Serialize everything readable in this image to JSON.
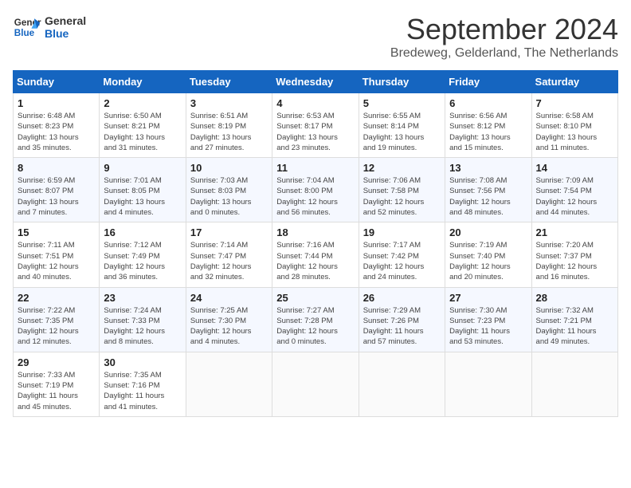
{
  "logo": {
    "line1": "General",
    "line2": "Blue"
  },
  "title": "September 2024",
  "subtitle": "Bredeweg, Gelderland, The Netherlands",
  "weekdays": [
    "Sunday",
    "Monday",
    "Tuesday",
    "Wednesday",
    "Thursday",
    "Friday",
    "Saturday"
  ],
  "weeks": [
    [
      {
        "day": "1",
        "info": "Sunrise: 6:48 AM\nSunset: 8:23 PM\nDaylight: 13 hours\nand 35 minutes."
      },
      {
        "day": "2",
        "info": "Sunrise: 6:50 AM\nSunset: 8:21 PM\nDaylight: 13 hours\nand 31 minutes."
      },
      {
        "day": "3",
        "info": "Sunrise: 6:51 AM\nSunset: 8:19 PM\nDaylight: 13 hours\nand 27 minutes."
      },
      {
        "day": "4",
        "info": "Sunrise: 6:53 AM\nSunset: 8:17 PM\nDaylight: 13 hours\nand 23 minutes."
      },
      {
        "day": "5",
        "info": "Sunrise: 6:55 AM\nSunset: 8:14 PM\nDaylight: 13 hours\nand 19 minutes."
      },
      {
        "day": "6",
        "info": "Sunrise: 6:56 AM\nSunset: 8:12 PM\nDaylight: 13 hours\nand 15 minutes."
      },
      {
        "day": "7",
        "info": "Sunrise: 6:58 AM\nSunset: 8:10 PM\nDaylight: 13 hours\nand 11 minutes."
      }
    ],
    [
      {
        "day": "8",
        "info": "Sunrise: 6:59 AM\nSunset: 8:07 PM\nDaylight: 13 hours\nand 7 minutes."
      },
      {
        "day": "9",
        "info": "Sunrise: 7:01 AM\nSunset: 8:05 PM\nDaylight: 13 hours\nand 4 minutes."
      },
      {
        "day": "10",
        "info": "Sunrise: 7:03 AM\nSunset: 8:03 PM\nDaylight: 13 hours\nand 0 minutes."
      },
      {
        "day": "11",
        "info": "Sunrise: 7:04 AM\nSunset: 8:00 PM\nDaylight: 12 hours\nand 56 minutes."
      },
      {
        "day": "12",
        "info": "Sunrise: 7:06 AM\nSunset: 7:58 PM\nDaylight: 12 hours\nand 52 minutes."
      },
      {
        "day": "13",
        "info": "Sunrise: 7:08 AM\nSunset: 7:56 PM\nDaylight: 12 hours\nand 48 minutes."
      },
      {
        "day": "14",
        "info": "Sunrise: 7:09 AM\nSunset: 7:54 PM\nDaylight: 12 hours\nand 44 minutes."
      }
    ],
    [
      {
        "day": "15",
        "info": "Sunrise: 7:11 AM\nSunset: 7:51 PM\nDaylight: 12 hours\nand 40 minutes."
      },
      {
        "day": "16",
        "info": "Sunrise: 7:12 AM\nSunset: 7:49 PM\nDaylight: 12 hours\nand 36 minutes."
      },
      {
        "day": "17",
        "info": "Sunrise: 7:14 AM\nSunset: 7:47 PM\nDaylight: 12 hours\nand 32 minutes."
      },
      {
        "day": "18",
        "info": "Sunrise: 7:16 AM\nSunset: 7:44 PM\nDaylight: 12 hours\nand 28 minutes."
      },
      {
        "day": "19",
        "info": "Sunrise: 7:17 AM\nSunset: 7:42 PM\nDaylight: 12 hours\nand 24 minutes."
      },
      {
        "day": "20",
        "info": "Sunrise: 7:19 AM\nSunset: 7:40 PM\nDaylight: 12 hours\nand 20 minutes."
      },
      {
        "day": "21",
        "info": "Sunrise: 7:20 AM\nSunset: 7:37 PM\nDaylight: 12 hours\nand 16 minutes."
      }
    ],
    [
      {
        "day": "22",
        "info": "Sunrise: 7:22 AM\nSunset: 7:35 PM\nDaylight: 12 hours\nand 12 minutes."
      },
      {
        "day": "23",
        "info": "Sunrise: 7:24 AM\nSunset: 7:33 PM\nDaylight: 12 hours\nand 8 minutes."
      },
      {
        "day": "24",
        "info": "Sunrise: 7:25 AM\nSunset: 7:30 PM\nDaylight: 12 hours\nand 4 minutes."
      },
      {
        "day": "25",
        "info": "Sunrise: 7:27 AM\nSunset: 7:28 PM\nDaylight: 12 hours\nand 0 minutes."
      },
      {
        "day": "26",
        "info": "Sunrise: 7:29 AM\nSunset: 7:26 PM\nDaylight: 11 hours\nand 57 minutes."
      },
      {
        "day": "27",
        "info": "Sunrise: 7:30 AM\nSunset: 7:23 PM\nDaylight: 11 hours\nand 53 minutes."
      },
      {
        "day": "28",
        "info": "Sunrise: 7:32 AM\nSunset: 7:21 PM\nDaylight: 11 hours\nand 49 minutes."
      }
    ],
    [
      {
        "day": "29",
        "info": "Sunrise: 7:33 AM\nSunset: 7:19 PM\nDaylight: 11 hours\nand 45 minutes."
      },
      {
        "day": "30",
        "info": "Sunrise: 7:35 AM\nSunset: 7:16 PM\nDaylight: 11 hours\nand 41 minutes."
      },
      {
        "day": "",
        "info": ""
      },
      {
        "day": "",
        "info": ""
      },
      {
        "day": "",
        "info": ""
      },
      {
        "day": "",
        "info": ""
      },
      {
        "day": "",
        "info": ""
      }
    ]
  ]
}
